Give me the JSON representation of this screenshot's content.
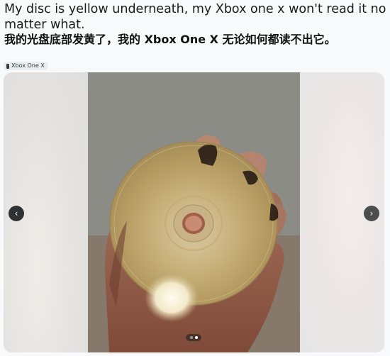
{
  "post": {
    "title": "My disc is yellow underneath, my Xbox one x won't read it no matter what.",
    "translation": "我的光盘底部发黄了，我的 Xbox One X 无论如何都读不出它。",
    "flair": "Xbox One X"
  },
  "gallery": {
    "image_count": 2,
    "current_index": 1,
    "prev_icon": "chevron-left-icon",
    "next_icon": "chevron-right-icon",
    "prev_glyph": "‹",
    "next_glyph": "›"
  },
  "colors": {
    "background": "#f7f9fb",
    "nav_button": "#2f3133",
    "disc_gold": "#c9b078"
  }
}
